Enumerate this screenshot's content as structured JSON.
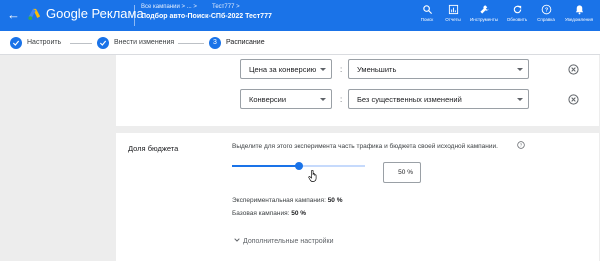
{
  "app": {
    "brand": "Google Реклама",
    "breadcrumb_campaigns": "Все кампании > ... >",
    "breadcrumb_test": "Тест777 >",
    "page_title": "Подбор авто-Поиск-СПб-2022 Тест777"
  },
  "toolbar": [
    {
      "label": "Поиск",
      "icon": "search-icon"
    },
    {
      "label": "Отчеты",
      "icon": "reports-icon"
    },
    {
      "label": "Инструменты",
      "icon": "tools-icon"
    },
    {
      "label": "Обновить",
      "icon": "refresh-icon"
    },
    {
      "label": "Справка",
      "icon": "help-icon"
    },
    {
      "label": "Уведомления",
      "icon": "bell-icon"
    }
  ],
  "stepper": [
    {
      "label": "Настроить",
      "done": true
    },
    {
      "label": "Внести изменения",
      "done": true
    },
    {
      "label": "Расписание",
      "number": "3",
      "active": true
    }
  ],
  "rules": [
    {
      "metric": "Цена за конверсию",
      "operator": ":",
      "value": "Уменьшить"
    },
    {
      "metric": "Конверсии",
      "operator": ":",
      "value": "Без существенных изменений"
    }
  ],
  "budget": {
    "title": "Доля бюджета",
    "description": "Выделите для этого эксперимента часть трафика и бюджета своей исходной кампании.",
    "slider_percent": 50,
    "input_value": "50 %",
    "experiment_label": "Экспериментальная кампания:",
    "experiment_value": "50 %",
    "base_label": "Базовая кампания:",
    "base_value": "50 %",
    "more_settings": "Дополнительные настройки"
  },
  "colors": {
    "brand_blue": "#1a73e8",
    "track_light": "#c6dafc",
    "background": "#ededed"
  }
}
